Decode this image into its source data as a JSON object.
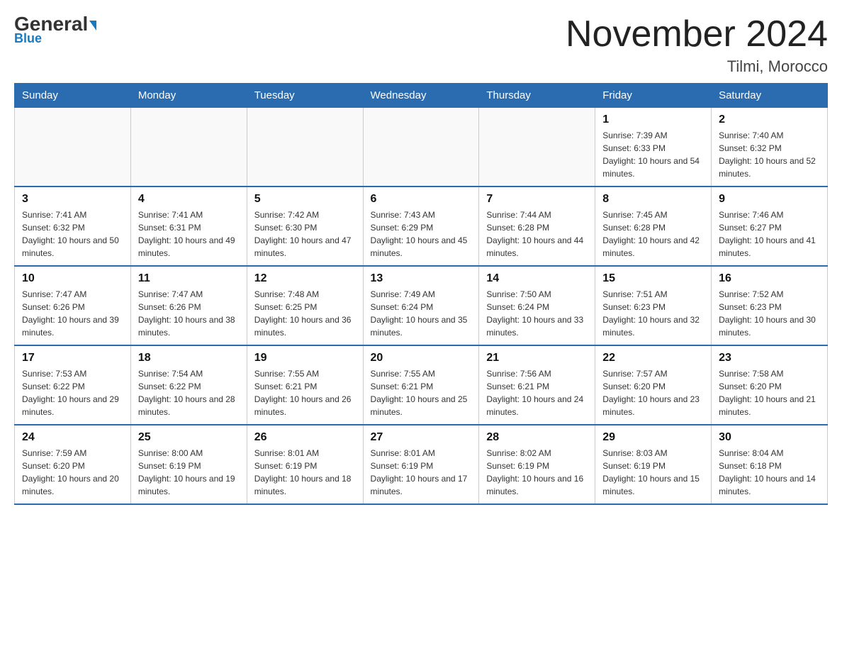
{
  "header": {
    "logo_general": "General",
    "logo_blue": "Blue",
    "month_title": "November 2024",
    "location": "Tilmi, Morocco"
  },
  "weekdays": [
    "Sunday",
    "Monday",
    "Tuesday",
    "Wednesday",
    "Thursday",
    "Friday",
    "Saturday"
  ],
  "weeks": [
    [
      {
        "day": "",
        "info": ""
      },
      {
        "day": "",
        "info": ""
      },
      {
        "day": "",
        "info": ""
      },
      {
        "day": "",
        "info": ""
      },
      {
        "day": "",
        "info": ""
      },
      {
        "day": "1",
        "info": "Sunrise: 7:39 AM\nSunset: 6:33 PM\nDaylight: 10 hours and 54 minutes."
      },
      {
        "day": "2",
        "info": "Sunrise: 7:40 AM\nSunset: 6:32 PM\nDaylight: 10 hours and 52 minutes."
      }
    ],
    [
      {
        "day": "3",
        "info": "Sunrise: 7:41 AM\nSunset: 6:32 PM\nDaylight: 10 hours and 50 minutes."
      },
      {
        "day": "4",
        "info": "Sunrise: 7:41 AM\nSunset: 6:31 PM\nDaylight: 10 hours and 49 minutes."
      },
      {
        "day": "5",
        "info": "Sunrise: 7:42 AM\nSunset: 6:30 PM\nDaylight: 10 hours and 47 minutes."
      },
      {
        "day": "6",
        "info": "Sunrise: 7:43 AM\nSunset: 6:29 PM\nDaylight: 10 hours and 45 minutes."
      },
      {
        "day": "7",
        "info": "Sunrise: 7:44 AM\nSunset: 6:28 PM\nDaylight: 10 hours and 44 minutes."
      },
      {
        "day": "8",
        "info": "Sunrise: 7:45 AM\nSunset: 6:28 PM\nDaylight: 10 hours and 42 minutes."
      },
      {
        "day": "9",
        "info": "Sunrise: 7:46 AM\nSunset: 6:27 PM\nDaylight: 10 hours and 41 minutes."
      }
    ],
    [
      {
        "day": "10",
        "info": "Sunrise: 7:47 AM\nSunset: 6:26 PM\nDaylight: 10 hours and 39 minutes."
      },
      {
        "day": "11",
        "info": "Sunrise: 7:47 AM\nSunset: 6:26 PM\nDaylight: 10 hours and 38 minutes."
      },
      {
        "day": "12",
        "info": "Sunrise: 7:48 AM\nSunset: 6:25 PM\nDaylight: 10 hours and 36 minutes."
      },
      {
        "day": "13",
        "info": "Sunrise: 7:49 AM\nSunset: 6:24 PM\nDaylight: 10 hours and 35 minutes."
      },
      {
        "day": "14",
        "info": "Sunrise: 7:50 AM\nSunset: 6:24 PM\nDaylight: 10 hours and 33 minutes."
      },
      {
        "day": "15",
        "info": "Sunrise: 7:51 AM\nSunset: 6:23 PM\nDaylight: 10 hours and 32 minutes."
      },
      {
        "day": "16",
        "info": "Sunrise: 7:52 AM\nSunset: 6:23 PM\nDaylight: 10 hours and 30 minutes."
      }
    ],
    [
      {
        "day": "17",
        "info": "Sunrise: 7:53 AM\nSunset: 6:22 PM\nDaylight: 10 hours and 29 minutes."
      },
      {
        "day": "18",
        "info": "Sunrise: 7:54 AM\nSunset: 6:22 PM\nDaylight: 10 hours and 28 minutes."
      },
      {
        "day": "19",
        "info": "Sunrise: 7:55 AM\nSunset: 6:21 PM\nDaylight: 10 hours and 26 minutes."
      },
      {
        "day": "20",
        "info": "Sunrise: 7:55 AM\nSunset: 6:21 PM\nDaylight: 10 hours and 25 minutes."
      },
      {
        "day": "21",
        "info": "Sunrise: 7:56 AM\nSunset: 6:21 PM\nDaylight: 10 hours and 24 minutes."
      },
      {
        "day": "22",
        "info": "Sunrise: 7:57 AM\nSunset: 6:20 PM\nDaylight: 10 hours and 23 minutes."
      },
      {
        "day": "23",
        "info": "Sunrise: 7:58 AM\nSunset: 6:20 PM\nDaylight: 10 hours and 21 minutes."
      }
    ],
    [
      {
        "day": "24",
        "info": "Sunrise: 7:59 AM\nSunset: 6:20 PM\nDaylight: 10 hours and 20 minutes."
      },
      {
        "day": "25",
        "info": "Sunrise: 8:00 AM\nSunset: 6:19 PM\nDaylight: 10 hours and 19 minutes."
      },
      {
        "day": "26",
        "info": "Sunrise: 8:01 AM\nSunset: 6:19 PM\nDaylight: 10 hours and 18 minutes."
      },
      {
        "day": "27",
        "info": "Sunrise: 8:01 AM\nSunset: 6:19 PM\nDaylight: 10 hours and 17 minutes."
      },
      {
        "day": "28",
        "info": "Sunrise: 8:02 AM\nSunset: 6:19 PM\nDaylight: 10 hours and 16 minutes."
      },
      {
        "day": "29",
        "info": "Sunrise: 8:03 AM\nSunset: 6:19 PM\nDaylight: 10 hours and 15 minutes."
      },
      {
        "day": "30",
        "info": "Sunrise: 8:04 AM\nSunset: 6:18 PM\nDaylight: 10 hours and 14 minutes."
      }
    ]
  ]
}
